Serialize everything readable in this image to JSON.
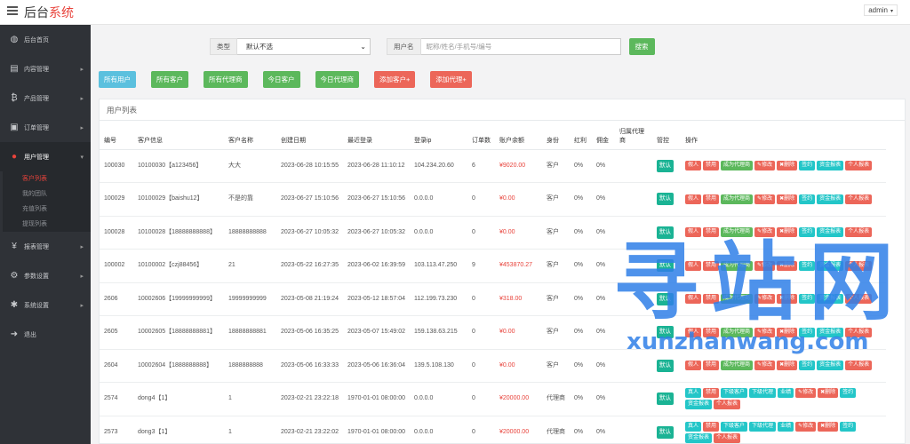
{
  "app": {
    "brand_main": "后台",
    "brand_accent": "系统",
    "user": "admin"
  },
  "sidebar": {
    "items": [
      {
        "label": "后台首页",
        "icon": "dashboard-icon",
        "glyph": "◍"
      },
      {
        "label": "内容管理",
        "icon": "content-icon",
        "glyph": "▤"
      },
      {
        "label": "产品管理",
        "icon": "bitcoin-icon",
        "glyph": "₿"
      },
      {
        "label": "订单管理",
        "icon": "order-icon",
        "glyph": "▣"
      },
      {
        "label": "用户管理",
        "icon": "user-icon",
        "glyph": "●"
      },
      {
        "label": "报表管理",
        "icon": "yen-icon",
        "glyph": "¥"
      },
      {
        "label": "参数设置",
        "icon": "settings-icon",
        "glyph": "⚙"
      },
      {
        "label": "系统设置",
        "icon": "gears-icon",
        "glyph": "✱"
      },
      {
        "label": "退出",
        "icon": "logout-icon",
        "glyph": "➜"
      }
    ],
    "submenu": [
      "客户列表",
      "我的团队",
      "充值列表",
      "提现列表"
    ]
  },
  "search": {
    "type_label": "类型",
    "type_value": "默认不选",
    "user_label": "用户名",
    "user_placeholder": "昵称/姓名/手机号/编号",
    "button": "搜索"
  },
  "filters": [
    {
      "label": "所有用户",
      "color": "teal"
    },
    {
      "label": "所有客户",
      "color": "green"
    },
    {
      "label": "所有代理商",
      "color": "green"
    },
    {
      "label": "今日客户",
      "color": "green"
    },
    {
      "label": "今日代理商",
      "color": "green"
    },
    {
      "label": "添加客户+",
      "color": "red"
    },
    {
      "label": "添加代理+",
      "color": "red"
    }
  ],
  "panel_title": "用户列表",
  "table": {
    "headers": [
      "编号",
      "客户信息",
      "客户名称",
      "创建日期",
      "最近登录",
      "登录ip",
      "订单数",
      "账户余额",
      "身份",
      "红利",
      "佣金",
      "归属代理商",
      "管控",
      "操作"
    ],
    "rows": [
      {
        "id": "100030",
        "info": "10100030【a123456】",
        "name": "大大",
        "created": "2023-06-28 10:15:55",
        "login": "2023-06-28 11:10:12",
        "ip": "104.234.20.60",
        "orders": "6",
        "balance": "¥9020.00",
        "role": "客户",
        "bonus": "0%",
        "comm": "0%",
        "agent": "",
        "ctrl": "默认",
        "ops": "client"
      },
      {
        "id": "100029",
        "info": "10100029【baishu12】",
        "name": "不是的靠",
        "created": "2023-06-27 15:10:56",
        "login": "2023-06-27 15:10:56",
        "ip": "0.0.0.0",
        "orders": "0",
        "balance": "¥0.00",
        "role": "客户",
        "bonus": "0%",
        "comm": "0%",
        "agent": "",
        "ctrl": "默认",
        "ops": "client"
      },
      {
        "id": "100028",
        "info": "10100028【18888888888】",
        "name": "18888888888",
        "created": "2023-06-27 10:05:32",
        "login": "2023-06-27 10:05:32",
        "ip": "0.0.0.0",
        "orders": "0",
        "balance": "¥0.00",
        "role": "客户",
        "bonus": "0%",
        "comm": "0%",
        "agent": "",
        "ctrl": "默认",
        "ops": "client"
      },
      {
        "id": "100002",
        "info": "10100002【czj88456】",
        "name": "21",
        "created": "2023-05-22 16:27:35",
        "login": "2023-06-02 16:39:59",
        "ip": "103.113.47.250",
        "orders": "9",
        "balance": "¥453870.27",
        "role": "客户",
        "bonus": "0%",
        "comm": "0%",
        "agent": "",
        "ctrl": "默认",
        "ops": "client"
      },
      {
        "id": "2606",
        "info": "10002606【19999999999】",
        "name": "19999999999",
        "created": "2023-05-08 21:19:24",
        "login": "2023-05-12 18:57:04",
        "ip": "112.199.73.230",
        "orders": "0",
        "balance": "¥318.00",
        "role": "客户",
        "bonus": "0%",
        "comm": "0%",
        "agent": "",
        "ctrl": "默认",
        "ops": "client"
      },
      {
        "id": "2605",
        "info": "10002605【18888888881】",
        "name": "18888888881",
        "created": "2023-05-06 16:35:25",
        "login": "2023-05-07 15:49:02",
        "ip": "159.138.63.215",
        "orders": "0",
        "balance": "¥0.00",
        "role": "客户",
        "bonus": "0%",
        "comm": "0%",
        "agent": "",
        "ctrl": "默认",
        "ops": "client"
      },
      {
        "id": "2604",
        "info": "10002604【1888888888】",
        "name": "1888888888",
        "created": "2023-05-06 16:33:33",
        "login": "2023-05-06 16:36:04",
        "ip": "139.5.108.130",
        "orders": "0",
        "balance": "¥0.00",
        "role": "客户",
        "bonus": "0%",
        "comm": "0%",
        "agent": "",
        "ctrl": "默认",
        "ops": "client"
      },
      {
        "id": "2574",
        "info": "dong4【1】",
        "name": "1",
        "created": "2023-02-21 23:22:18",
        "login": "1970-01-01 08:00:00",
        "ip": "0.0.0.0",
        "orders": "0",
        "balance": "¥20000.00",
        "role": "代理商",
        "bonus": "0%",
        "comm": "0%",
        "agent": "",
        "ctrl": "默认",
        "ops": "agent"
      },
      {
        "id": "2573",
        "info": "dong3【1】",
        "name": "1",
        "created": "2023-02-21 23:22:02",
        "login": "1970-01-01 08:00:00",
        "ip": "0.0.0.0",
        "orders": "0",
        "balance": "¥20000.00",
        "role": "代理商",
        "bonus": "0%",
        "comm": "0%",
        "agent": "",
        "ctrl": "默认",
        "ops": "agent"
      }
    ],
    "client_ops": [
      {
        "label": "假人",
        "color": "red"
      },
      {
        "label": "禁用",
        "color": "red"
      },
      {
        "label": "成为代理商",
        "color": "green"
      },
      {
        "label": "✎修改",
        "color": "red"
      },
      {
        "label": "✖删除",
        "color": "red"
      },
      {
        "label": "签约",
        "color": "teal"
      },
      {
        "label": "资金报表",
        "color": "teal"
      },
      {
        "label": "个人报表",
        "color": "red"
      }
    ],
    "agent_ops": [
      {
        "label": "真人",
        "color": "teal"
      },
      {
        "label": "禁用",
        "color": "red"
      },
      {
        "label": "下级客户",
        "color": "teal"
      },
      {
        "label": "下级代理",
        "color": "teal"
      },
      {
        "label": "业绩",
        "color": "teal"
      },
      {
        "label": "✎修改",
        "color": "red"
      },
      {
        "label": "✖删除",
        "color": "red"
      },
      {
        "label": "签约",
        "color": "teal"
      },
      {
        "label": "资金报表",
        "color": "teal"
      },
      {
        "label": "个人报表",
        "color": "red"
      }
    ]
  },
  "watermark": {
    "text": "寻站网",
    "url": "xunzhanwang.com"
  }
}
